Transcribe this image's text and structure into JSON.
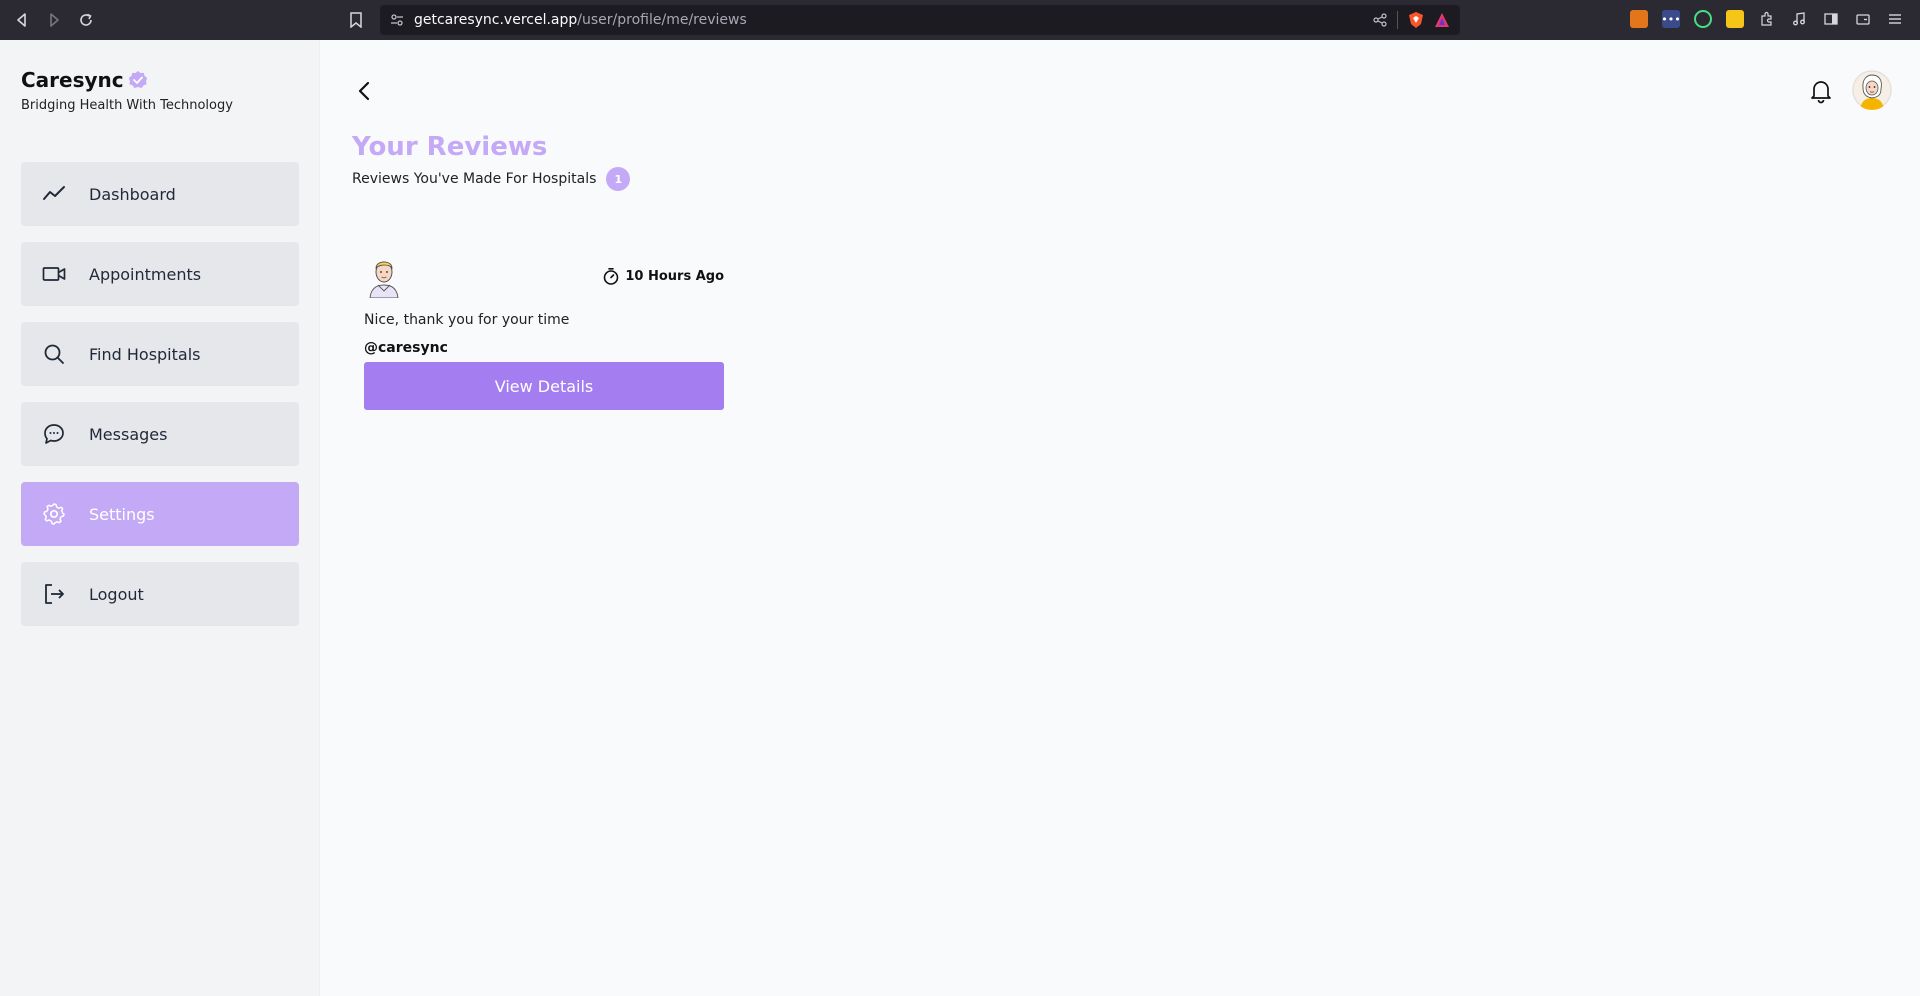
{
  "browser": {
    "url_host": "getcaresync.vercel.app",
    "url_path": "/user/profile/me/reviews"
  },
  "brand": {
    "title": "Caresync",
    "tagline": "Bridging Health With Technology",
    "accent": "#c4a9f7"
  },
  "sidebar": {
    "items": [
      {
        "label": "Dashboard",
        "icon": "trend-line-icon",
        "active": false
      },
      {
        "label": "Appointments",
        "icon": "video-camera-icon",
        "active": false
      },
      {
        "label": "Find Hospitals",
        "icon": "search-icon",
        "active": false
      },
      {
        "label": "Messages",
        "icon": "chat-bubble-icon",
        "active": false
      },
      {
        "label": "Settings",
        "icon": "gear-icon",
        "active": true
      },
      {
        "label": "Logout",
        "icon": "logout-icon",
        "active": false
      }
    ]
  },
  "page": {
    "title": "Your Reviews",
    "subtitle": "Reviews You've Made For Hospitals",
    "count": "1"
  },
  "review": {
    "time": "10 Hours Ago",
    "text": "Nice, thank you for your time",
    "handle": "@caresync",
    "button_label": "View Details"
  },
  "colors": {
    "button": "#a47ef0",
    "active_nav": "#c4a9f7"
  }
}
